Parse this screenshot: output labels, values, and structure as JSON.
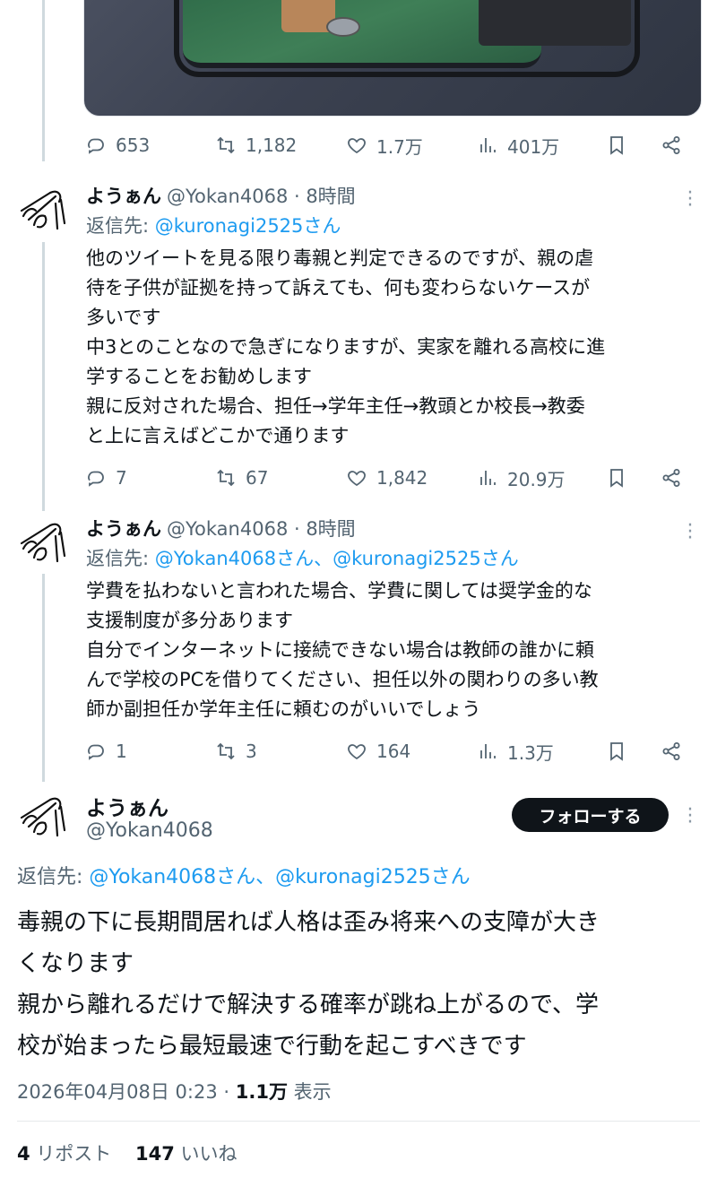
{
  "top_tweet": {
    "stats": {
      "replies": "653",
      "retweets": "1,182",
      "likes": "1.7万",
      "views": "401万"
    }
  },
  "replies": [
    {
      "name": "ようぁん",
      "meta": "@Yokan4068 · 8時間",
      "reply_prefix": "返信先:",
      "reply_to": "@kuronagi2525さん",
      "lines": [
        "他のツイートを見る限り毒親と判定できるのですが、親の虐",
        "待を子供が証拠を持って訴えても、何も変わらないケースが",
        "多いです",
        "中3とのことなので急ぎになりますが、実家を離れる高校に進",
        "学することをお勧めします",
        "親に反対された場合、担任→学年主任→教頭とか校長→教委",
        "と上に言えばどこかで通ります"
      ],
      "stats": {
        "replies": "7",
        "retweets": "67",
        "likes": "1,842",
        "views": "20.9万"
      }
    },
    {
      "name": "ようぁん",
      "meta": "@Yokan4068 · 8時間",
      "reply_prefix": "返信先:",
      "reply_to": "@Yokan4068さん、@kuronagi2525さん",
      "lines": [
        "学費を払わないと言われた場合、学費に関しては奨学金的な",
        "支援制度が多分あります",
        "自分でインターネットに接続できない場合は教師の誰かに頼",
        "んで学校のPCを借りてください、担任以外の関わりの多い教",
        "師か副担任か学年主任に頼むのがいいでしょう"
      ],
      "stats": {
        "replies": "1",
        "retweets": "3",
        "likes": "164",
        "views": "1.3万"
      }
    }
  ],
  "focus": {
    "name": "ようぁん",
    "handle": "@Yokan4068",
    "follow_label": "フォローする",
    "reply_prefix": "返信先:",
    "reply_to": "@Yokan4068さん、@kuronagi2525さん",
    "lines": [
      "毒親の下に長期間居れば人格は歪み将来への支障が大き",
      "くなります",
      "親から離れるだけで解決する確率が跳ね上がるので、学",
      "校が始まったら最短最速で行動を起こすべきです"
    ],
    "timestamp": "2026年04月08日 0:23 · ",
    "views_count": "1.1万",
    "views_label": " 表示",
    "repost_count": "4",
    "repost_label": " リポスト",
    "like_count": "147",
    "like_label": " いいね"
  },
  "icons": {
    "reply": "reply-icon",
    "retweet": "retweet-icon",
    "like": "heart-icon",
    "views": "views-icon",
    "bookmark": "bookmark-icon",
    "share": "share-icon"
  },
  "colors": {
    "link": "#1d9bf0",
    "muted": "#536471",
    "thread_line": "#cfd9de"
  }
}
